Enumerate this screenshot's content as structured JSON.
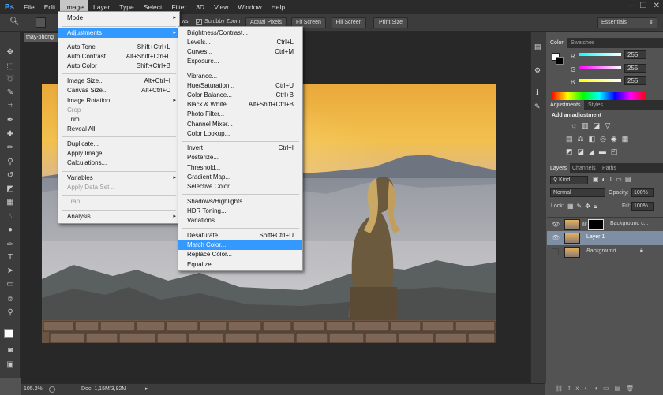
{
  "menubar": {
    "logo": "Ps",
    "items": [
      "File",
      "Edit",
      "Image",
      "Layer",
      "Type",
      "Select",
      "Filter",
      "3D",
      "View",
      "Window",
      "Help"
    ],
    "active": "Image"
  },
  "optbar": {
    "left_text": "ws",
    "scrubby_zoom": "Scrubby Zoom",
    "actual_pixels": "Actual Pixels",
    "fit_screen": "Fit Screen",
    "fill_screen": "Fill Screen",
    "print_size": "Print Size",
    "workspace": "Essentials"
  },
  "document": {
    "tab_title": "thay-phong",
    "zoom": "105.2%",
    "doc_size": "Doc: 1,15M/3,92M"
  },
  "image_menu": {
    "items": [
      {
        "label": "Mode",
        "submenu": true
      },
      {
        "label": "Adjustments",
        "submenu": true,
        "highlighted": true
      },
      {
        "label": "Auto Tone",
        "shortcut": "Shift+Ctrl+L"
      },
      {
        "label": "Auto Contrast",
        "shortcut": "Alt+Shift+Ctrl+L"
      },
      {
        "label": "Auto Color",
        "shortcut": "Shift+Ctrl+B"
      },
      {
        "label": "Image Size...",
        "shortcut": "Alt+Ctrl+I"
      },
      {
        "label": "Canvas Size...",
        "shortcut": "Alt+Ctrl+C"
      },
      {
        "label": "Image Rotation",
        "submenu": true
      },
      {
        "label": "Crop",
        "disabled": true
      },
      {
        "label": "Trim..."
      },
      {
        "label": "Reveal All"
      },
      {
        "label": "Duplicate..."
      },
      {
        "label": "Apply Image..."
      },
      {
        "label": "Calculations..."
      },
      {
        "label": "Variables",
        "submenu": true
      },
      {
        "label": "Apply Data Set...",
        "disabled": true
      },
      {
        "label": "Trap...",
        "disabled": true
      },
      {
        "label": "Analysis",
        "submenu": true
      }
    ]
  },
  "adjust_menu": {
    "items": [
      {
        "label": "Brightness/Contrast..."
      },
      {
        "label": "Levels...",
        "shortcut": "Ctrl+L"
      },
      {
        "label": "Curves...",
        "shortcut": "Ctrl+M"
      },
      {
        "label": "Exposure..."
      },
      {
        "label": "Vibrance..."
      },
      {
        "label": "Hue/Saturation...",
        "shortcut": "Ctrl+U"
      },
      {
        "label": "Color Balance...",
        "shortcut": "Ctrl+B"
      },
      {
        "label": "Black & White...",
        "shortcut": "Alt+Shift+Ctrl+B"
      },
      {
        "label": "Photo Filter..."
      },
      {
        "label": "Channel Mixer..."
      },
      {
        "label": "Color Lookup..."
      },
      {
        "label": "Invert",
        "shortcut": "Ctrl+I"
      },
      {
        "label": "Posterize..."
      },
      {
        "label": "Threshold..."
      },
      {
        "label": "Gradient Map..."
      },
      {
        "label": "Selective Color..."
      },
      {
        "label": "Shadows/Highlights..."
      },
      {
        "label": "HDR Toning..."
      },
      {
        "label": "Variations..."
      },
      {
        "label": "Desaturate",
        "shortcut": "Shift+Ctrl+U"
      },
      {
        "label": "Match Color...",
        "highlighted": true
      },
      {
        "label": "Replace Color..."
      },
      {
        "label": "Equalize"
      }
    ]
  },
  "color_panel": {
    "tabs": [
      "Color",
      "Swatches"
    ],
    "r_label": "R",
    "g_label": "G",
    "b_label": "B",
    "r": "255",
    "g": "255",
    "b": "255"
  },
  "adjustments_panel": {
    "tabs": [
      "Adjustments",
      "Styles"
    ],
    "heading": "Add an adjustment"
  },
  "layers_panel": {
    "tabs": [
      "Layers",
      "Channels",
      "Paths"
    ],
    "kind": "Kind",
    "blend_mode": "Normal",
    "opacity_label": "Opacity:",
    "opacity": "100%",
    "lock_label": "Lock:",
    "fill_label": "Fill:",
    "fill": "100%",
    "layers": [
      {
        "name": "Background c...",
        "selected": false,
        "italic": false
      },
      {
        "name": "Layer 1",
        "selected": true,
        "italic": false
      },
      {
        "name": "Background",
        "selected": false,
        "italic": true
      }
    ]
  }
}
